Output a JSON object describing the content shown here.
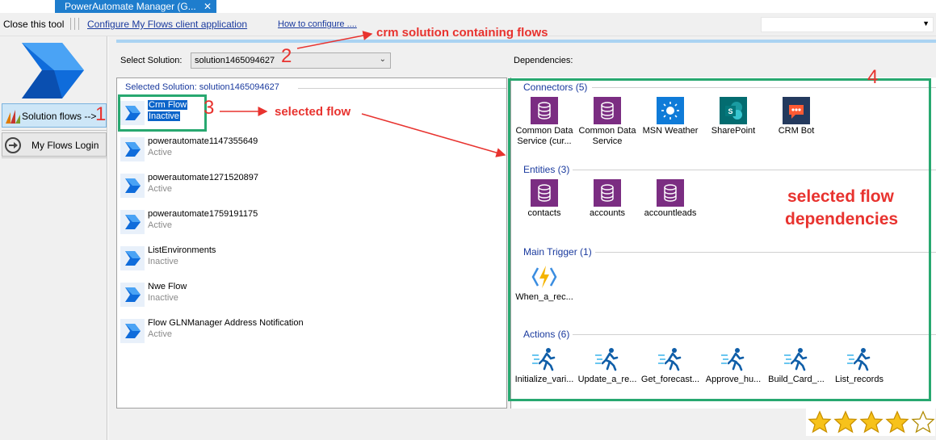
{
  "tab": {
    "title": "PowerAutomate Manager (G...",
    "close": "✕"
  },
  "toolbar": {
    "close_tool": "Close this tool",
    "configure_link": "Configure My Flows client application",
    "how_link": "How to configure ...."
  },
  "nav": {
    "solution_flows": "Solution flows -->",
    "my_flows_login": "My Flows Login"
  },
  "solution": {
    "select_label": "Select Solution:",
    "selected_value": "solution1465094627",
    "group_header": "Selected Solution: solution1465094627"
  },
  "flows": [
    {
      "name": "Crm Flow",
      "status": "Inactive"
    },
    {
      "name": "powerautomate1147355649",
      "status": "Active"
    },
    {
      "name": "powerautomate1271520897",
      "status": "Active"
    },
    {
      "name": "powerautomate1759191175",
      "status": "Active"
    },
    {
      "name": "ListEnvironments",
      "status": "Inactive"
    },
    {
      "name": "Nwe Flow",
      "status": "Inactive"
    },
    {
      "name": "Flow GLNManager Address Notification",
      "status": "Active"
    }
  ],
  "dependencies": {
    "label": "Dependencies:",
    "connectors_header": "Connectors (5)",
    "connectors": [
      {
        "label": "Common Data Service (cur...",
        "icon": "database-icon",
        "color": "#7b2d82"
      },
      {
        "label": "Common Data Service",
        "icon": "database-icon",
        "color": "#7b2d82"
      },
      {
        "label": "MSN Weather",
        "icon": "sun-icon",
        "color": "#0f7bd8"
      },
      {
        "label": "SharePoint",
        "icon": "sharepoint-icon",
        "color": "#036c70"
      },
      {
        "label": "CRM Bot",
        "icon": "bot-icon",
        "color": "#243a5e"
      }
    ],
    "entities_header": "Entities (3)",
    "entities": [
      {
        "label": "contacts",
        "icon": "database-icon",
        "color": "#7b2d82"
      },
      {
        "label": "accounts",
        "icon": "database-icon",
        "color": "#7b2d82"
      },
      {
        "label": "accountleads",
        "icon": "database-icon",
        "color": "#7b2d82"
      }
    ],
    "trigger_header": "Main Trigger (1)",
    "trigger": {
      "label": "When_a_rec...",
      "icon": "lightning-icon"
    },
    "actions_header": "Actions (6)",
    "actions": [
      {
        "label": "Initialize_vari...",
        "icon": "runner-icon"
      },
      {
        "label": "Update_a_re...",
        "icon": "runner-icon"
      },
      {
        "label": "Get_forecast...",
        "icon": "runner-icon"
      },
      {
        "label": "Approve_hu...",
        "icon": "runner-icon"
      },
      {
        "label": "Build_Card_...",
        "icon": "runner-icon"
      },
      {
        "label": "List_records",
        "icon": "runner-icon"
      }
    ]
  },
  "annotations": {
    "n1": "1",
    "n2": "2",
    "n3": "3",
    "n4": "4",
    "crm_solution": "crm solution containing flows",
    "selected_flow": "selected flow",
    "selected_deps_line1": "selected flow",
    "selected_deps_line2": "dependencies"
  },
  "rating": {
    "filled": 4,
    "total": 5
  },
  "colors": {
    "accent": "#0a63c9",
    "annotation": "#e8332f",
    "highlight_box": "#28a870",
    "tab": "#1e7dcd"
  }
}
